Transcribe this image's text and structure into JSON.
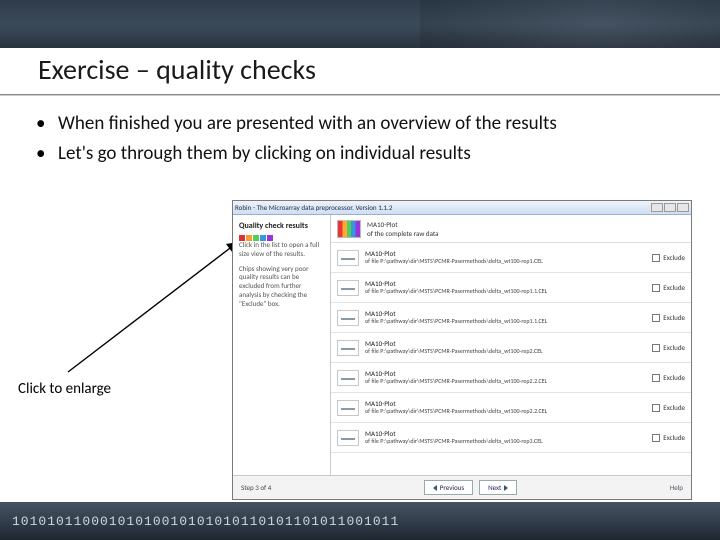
{
  "title": "Exercise – quality checks",
  "bullets": [
    "When finished you are presented with an overview of the results",
    "Let's go through them by clicking on individual results"
  ],
  "annotation": "Click to enlarge",
  "app": {
    "window_title": "Robin - The Microarray data preprocessor. Version 1.1.2",
    "sidebar": {
      "heading": "Quality check results",
      "line1": "Click in the list to open a full size view of the results.",
      "line2": "Chips showing very poor quality results can be excluded from further analysis by checking the \"Exclude\" box."
    },
    "top_item": {
      "name": "MA10-Plot",
      "path": "of the complete raw data"
    },
    "rows": [
      {
        "name": "MA10-Plot",
        "path": "of file  P:\\pathway\\dir\\MSTS\\PCMR-Pasermethods\\delta_wt100-rep1.CEL",
        "exclude_label": "Exclude"
      },
      {
        "name": "MA10-Plot",
        "path": "of file  P:\\pathway\\dir\\MSTS\\PCMR-Pasermethods\\delta_wt100-rep1.1.CEL",
        "exclude_label": "Exclude"
      },
      {
        "name": "MA10-Plot",
        "path": "of file  P:\\pathway\\dir\\MSTS\\PCMR-Pasermethods\\delta_wt100-rep1.1.CEL",
        "exclude_label": "Exclude"
      },
      {
        "name": "MA10-Plot",
        "path": "of file  P:\\pathway\\dir\\MSTS\\PCMR-Pasermethods\\delta_wt100-rep2.CEL",
        "exclude_label": "Exclude"
      },
      {
        "name": "MA10-Plot",
        "path": "of file  P:\\pathway\\dir\\MSTS\\PCMR-Pasermethods\\delta_wt100-rep2.2.CEL",
        "exclude_label": "Exclude"
      },
      {
        "name": "MA10-Plot",
        "path": "of file  P:\\pathway\\dir\\MSTS\\PCMR-Pasermethods\\delta_wt100-rep2.2.CEL",
        "exclude_label": "Exclude"
      },
      {
        "name": "MA10-Plot",
        "path": "of file  P:\\pathway\\dir\\MSTS\\PCMR-Pasermethods\\delta_wt100-rep3.CEL",
        "exclude_label": "Exclude"
      }
    ],
    "wizard": {
      "step_text": "Step 3 of 4",
      "prev_label": "Previous",
      "next_label": "Next",
      "help_label": "Help"
    }
  },
  "footer_binary": "10101011000101010010101010110101101011001011"
}
